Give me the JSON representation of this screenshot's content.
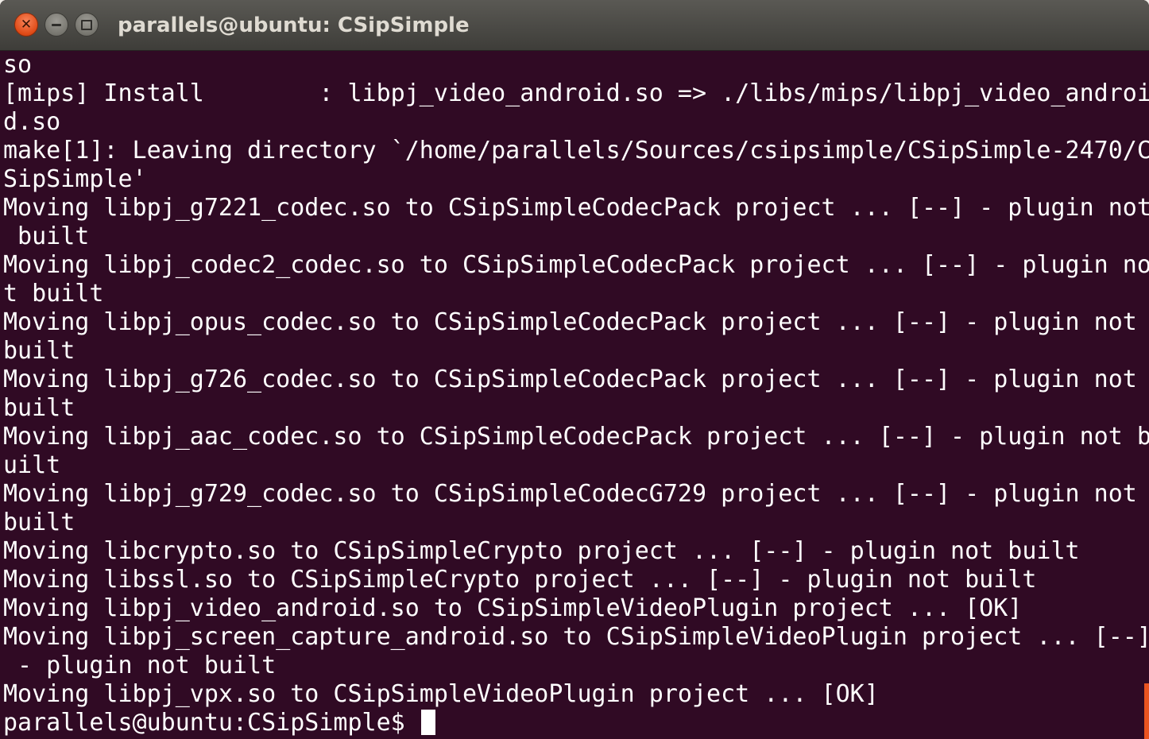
{
  "window": {
    "title": "parallels@ubuntu: CSipSimple",
    "controls": {
      "close_icon": "close-icon",
      "minimize_icon": "minimize-icon",
      "maximize_icon": "maximize-icon"
    },
    "colors": {
      "terminal_bg": "#300a24",
      "text": "#ffffff",
      "close_button": "#e0501a"
    }
  },
  "terminal": {
    "lines": [
      "so",
      "[mips] Install        : libpj_video_android.so => ./libs/mips/libpj_video_androi",
      "d.so",
      "make[1]: Leaving directory `/home/parallels/Sources/csipsimple/CSipSimple-2470/C",
      "SipSimple'",
      "Moving libpj_g7221_codec.so to CSipSimpleCodecPack project ... [--] - plugin not",
      " built",
      "Moving libpj_codec2_codec.so to CSipSimpleCodecPack project ... [--] - plugin no",
      "t built",
      "Moving libpj_opus_codec.so to CSipSimpleCodecPack project ... [--] - plugin not",
      "built",
      "Moving libpj_g726_codec.so to CSipSimpleCodecPack project ... [--] - plugin not",
      "built",
      "Moving libpj_aac_codec.so to CSipSimpleCodecPack project ... [--] - plugin not b",
      "uilt",
      "Moving libpj_g729_codec.so to CSipSimpleCodecG729 project ... [--] - plugin not",
      "built",
      "Moving libcrypto.so to CSipSimpleCrypto project ... [--] - plugin not built",
      "Moving libssl.so to CSipSimpleCrypto project ... [--] - plugin not built",
      "Moving libpj_video_android.so to CSipSimpleVideoPlugin project ... [OK]",
      "Moving libpj_screen_capture_android.so to CSipSimpleVideoPlugin project ... [--]",
      " - plugin not built",
      "Moving libpj_vpx.so to CSipSimpleVideoPlugin project ... [OK]"
    ],
    "prompt": "parallels@ubuntu:CSipSimple$ "
  }
}
